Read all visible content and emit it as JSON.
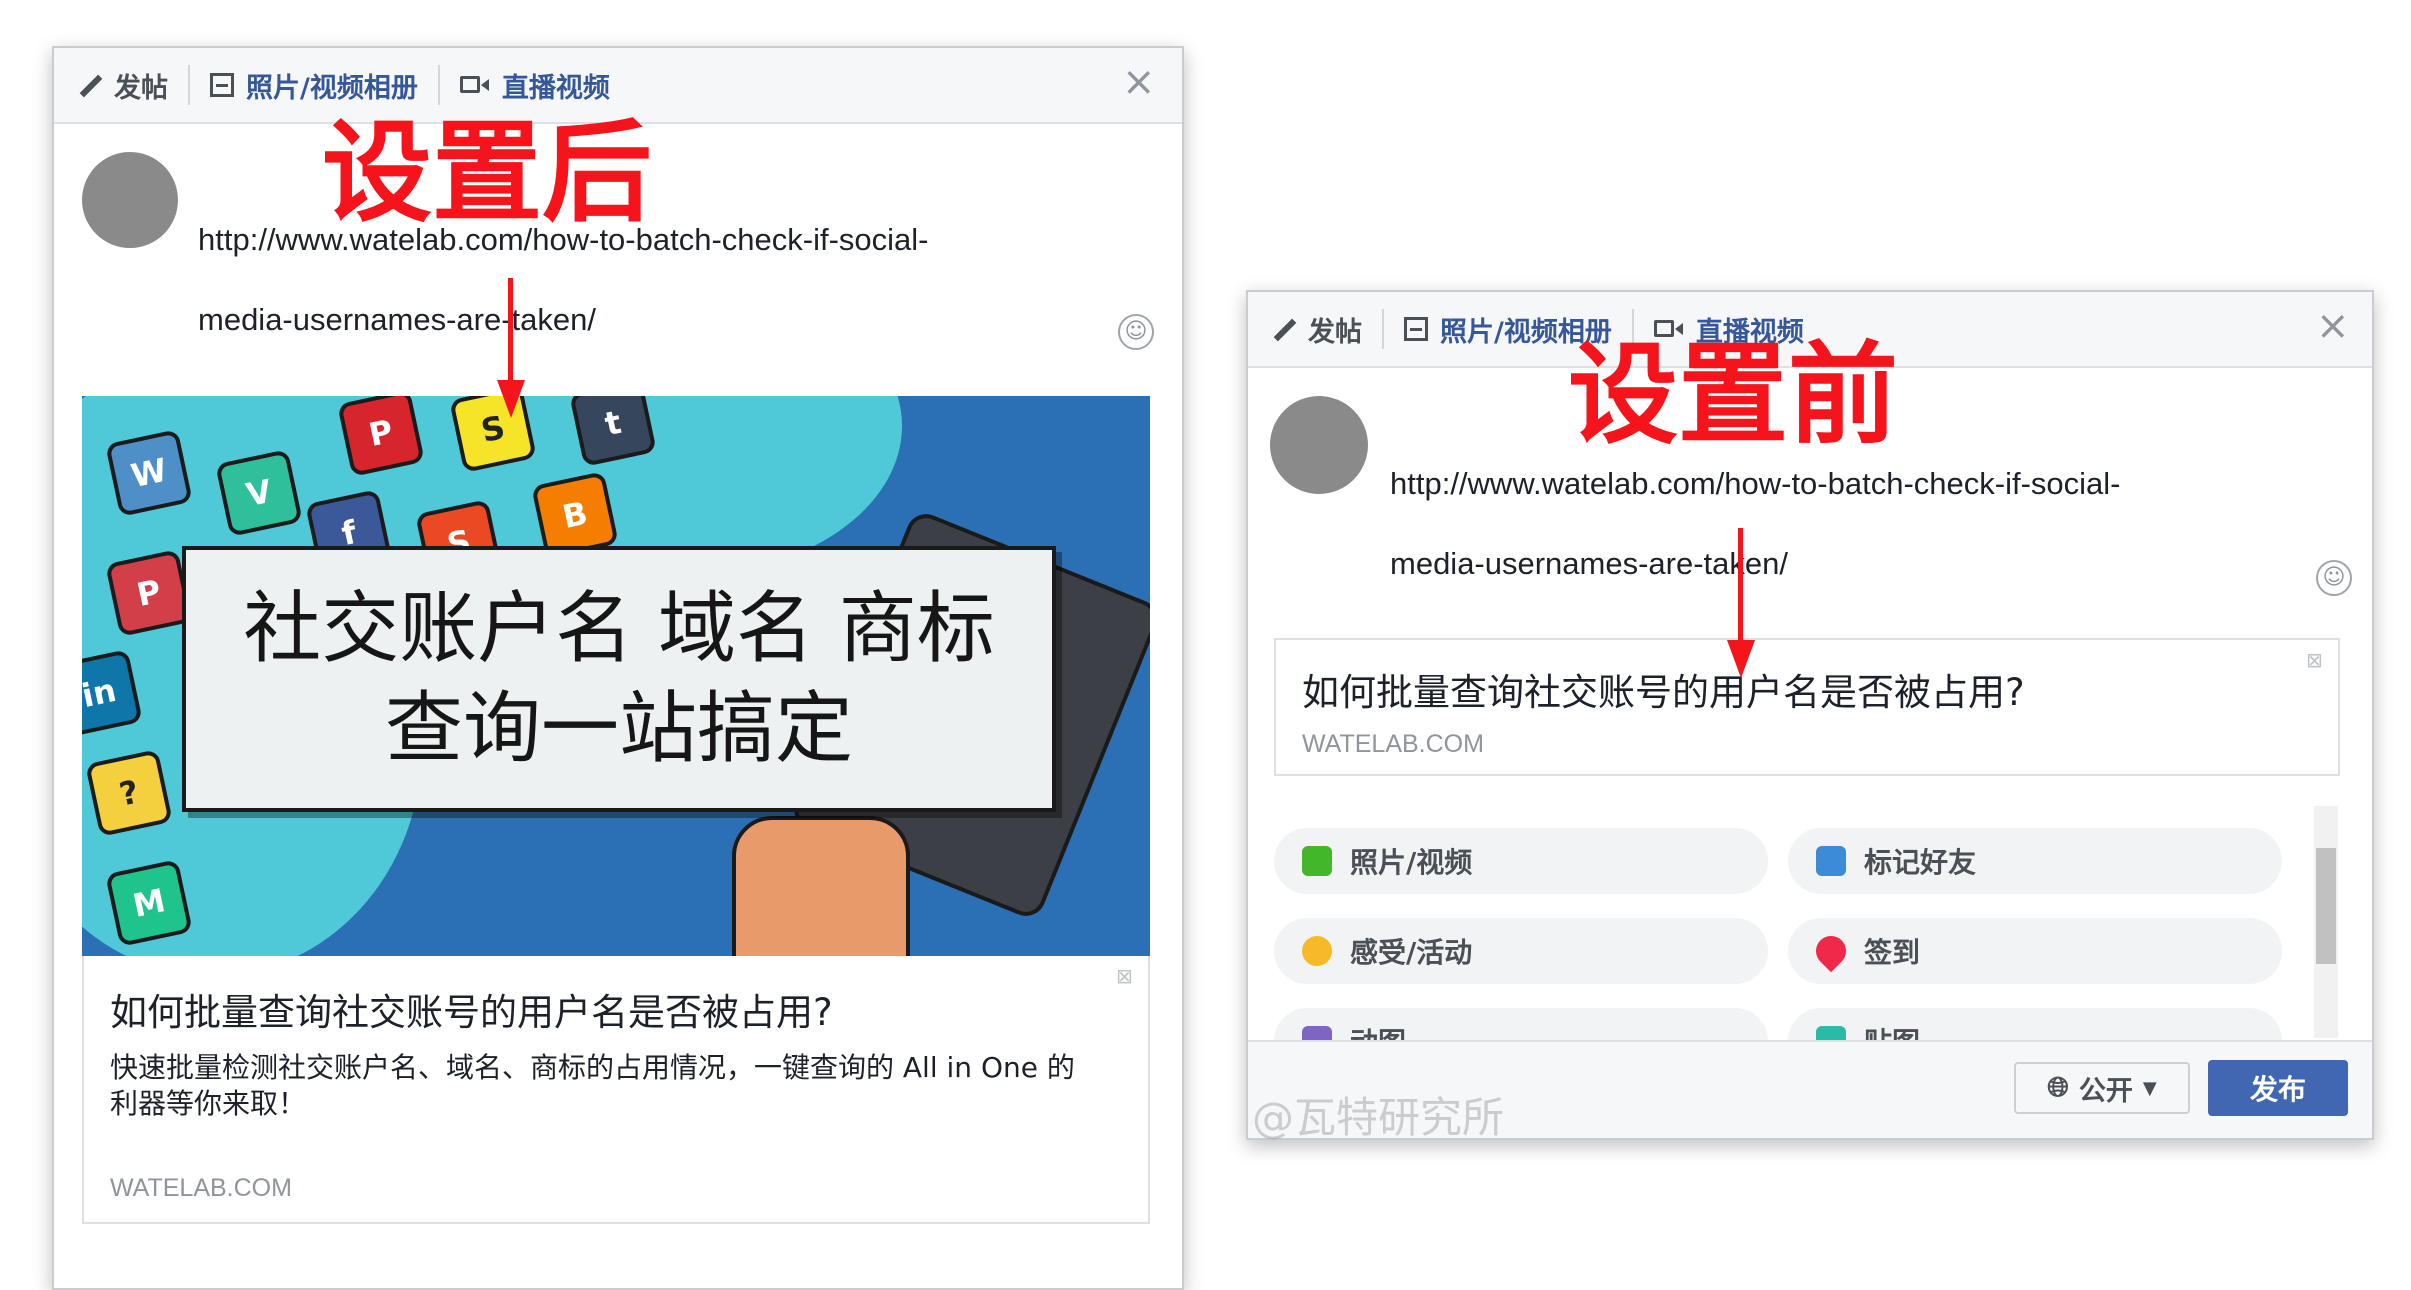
{
  "tabs": {
    "post": "发帖",
    "photo_album": "照片/视频相册",
    "live_video": "直播视频",
    "close": "×"
  },
  "after": {
    "annotation": "设置后",
    "url_line1": "http://www.watelab.com/how-to-batch-check-if-social-",
    "url_line2": "media-usernames-are-taken/",
    "hero_line1": "社交账户名  域名  商标",
    "hero_line2": "查询一站搞定",
    "card_title": "如何批量查询社交账号的用户名是否被占用?",
    "card_desc_line1": "快速批量检测社交账户名、域名、商标的占用情况，一键查询的 All in One 的",
    "card_desc_line2": "利器等你来取！",
    "card_domain": "WATELAB.COM"
  },
  "before": {
    "annotation": "设置前",
    "url_line1": "http://www.watelab.com/how-to-batch-check-if-social-",
    "url_line2": "media-usernames-are-taken/",
    "card_title": "如何批量查询社交账号的用户名是否被占用?",
    "card_domain": "WATELAB.COM",
    "options": [
      {
        "label": "照片/视频",
        "icon": "photo-icon",
        "color": "#42b72a"
      },
      {
        "label": "标记好友",
        "icon": "tag-friends-icon",
        "color": "#3b8bd6"
      },
      {
        "label": "感受/活动",
        "icon": "feeling-icon",
        "color": "#f7b928"
      },
      {
        "label": "签到",
        "icon": "checkin-pin-icon",
        "color": "#f02849"
      },
      {
        "label": "动图",
        "icon": "gif-icon",
        "color": "#7e64c4"
      },
      {
        "label": "贴图",
        "icon": "sticker-icon",
        "color": "#2abba7"
      }
    ],
    "audience": "公开",
    "post_button": "发布"
  },
  "watermark": "@瓦特研究所",
  "colors": {
    "annotation_red": "#f5141b",
    "link_blue": "#365899",
    "post_button": "#4267b2",
    "hero_bg": "#2b70b5"
  }
}
